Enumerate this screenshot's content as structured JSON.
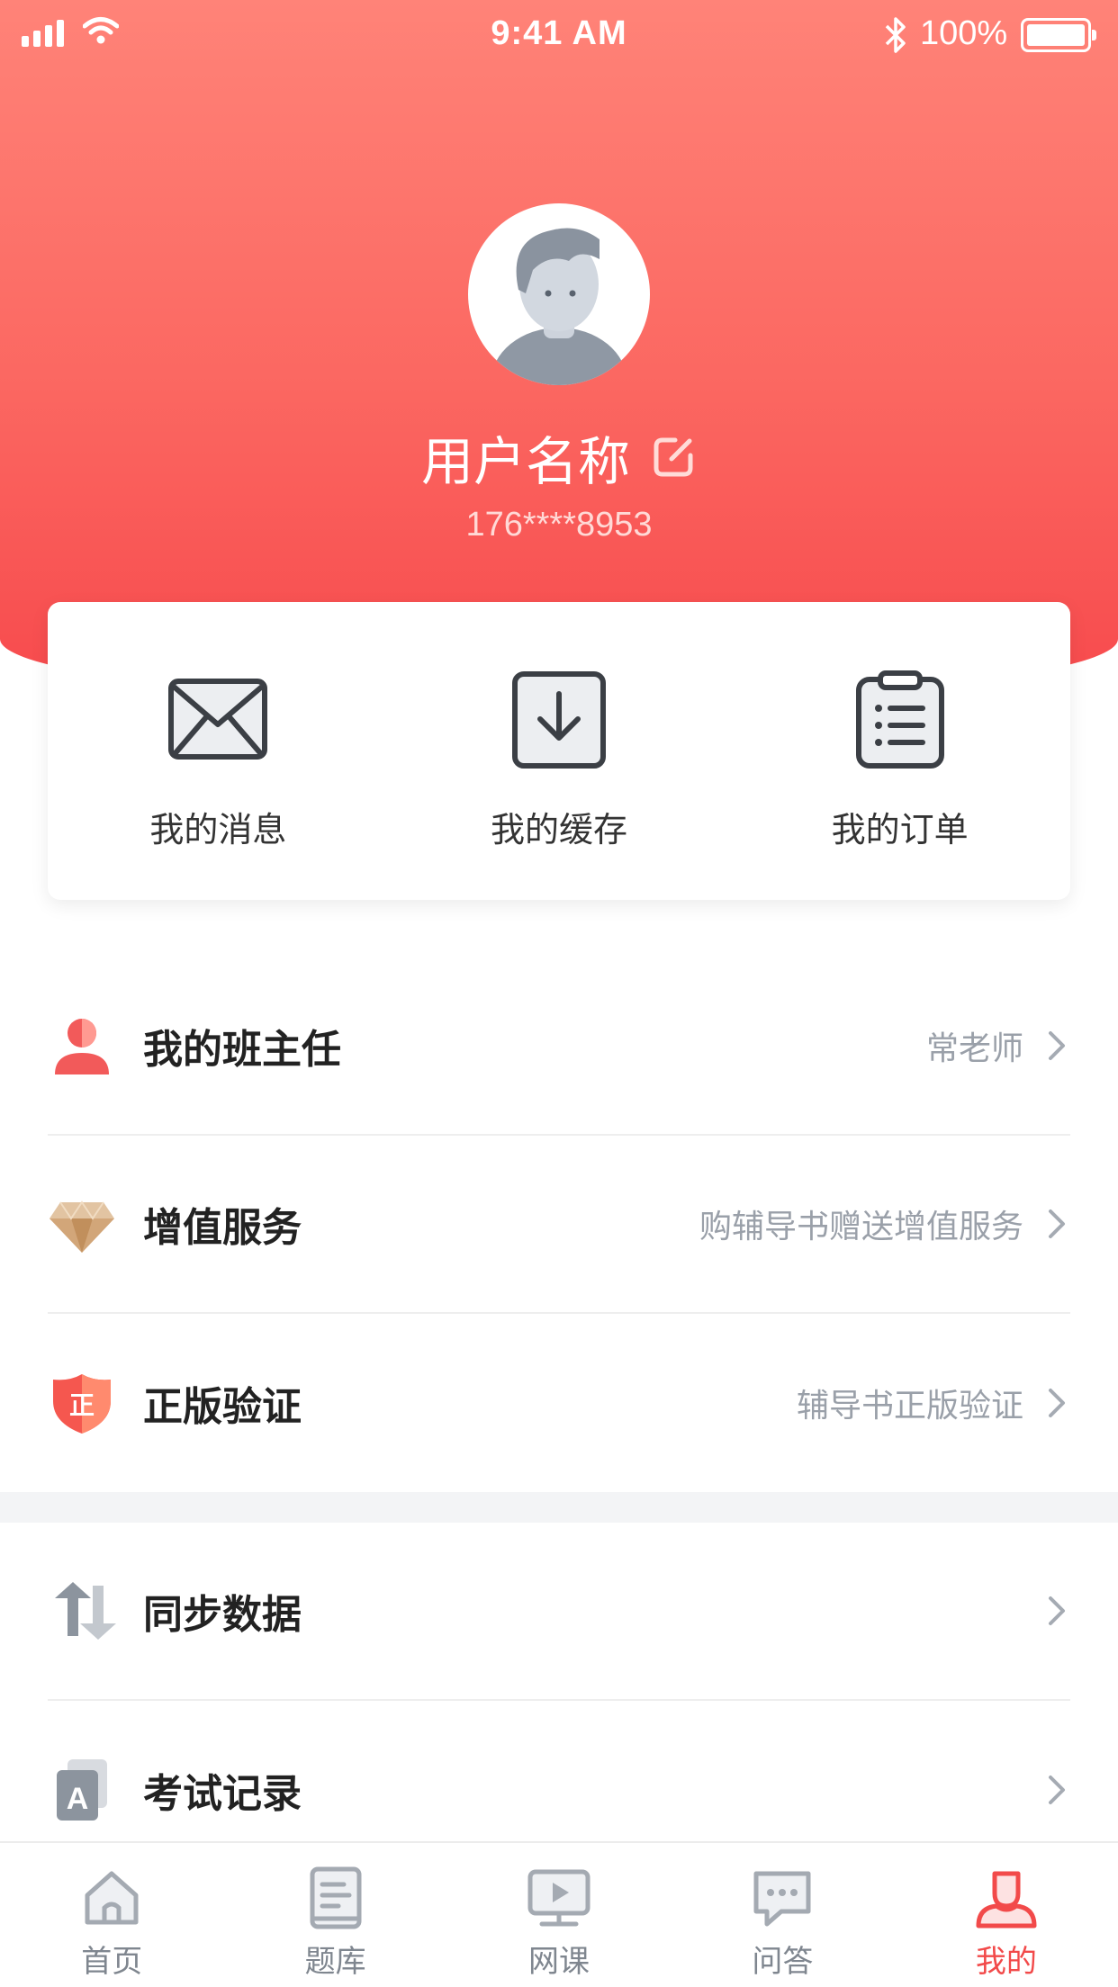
{
  "status_bar": {
    "time": "9:41 AM",
    "battery": "100%"
  },
  "profile": {
    "username": "用户名称",
    "phone": "176****8953"
  },
  "quick_actions": [
    {
      "label": "我的消息",
      "icon": "envelope-icon"
    },
    {
      "label": "我的缓存",
      "icon": "download-icon"
    },
    {
      "label": "我的订单",
      "icon": "clipboard-list-icon"
    }
  ],
  "menu": [
    {
      "title": "我的班主任",
      "value": "常老师",
      "icon": "teacher-icon"
    },
    {
      "title": "增值服务",
      "value": "购辅导书赠送增值服务",
      "icon": "diamond-icon"
    },
    {
      "title": "正版验证",
      "value": "辅导书正版验证",
      "icon": "shield-verify-icon"
    },
    {
      "title": "同步数据",
      "value": "",
      "icon": "sync-icon"
    },
    {
      "title": "考试记录",
      "value": "",
      "icon": "exam-record-icon"
    }
  ],
  "tabs": [
    {
      "label": "首页",
      "icon": "home-icon"
    },
    {
      "label": "题库",
      "icon": "question-bank-icon"
    },
    {
      "label": "网课",
      "icon": "video-course-icon"
    },
    {
      "label": "问答",
      "icon": "chat-icon"
    },
    {
      "label": "我的",
      "icon": "profile-icon",
      "active": true
    }
  ],
  "colors": {
    "accent": "#f24a4a",
    "header_top": "#ff8378",
    "header_bottom": "#f7494c"
  }
}
